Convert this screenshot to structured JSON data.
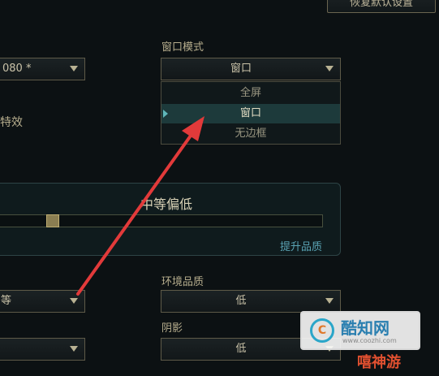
{
  "top_right": {
    "reset_label": "恢复默认设置"
  },
  "left_column": {
    "resolution_value": "080 *",
    "effects_label": "特效",
    "quality_value": "等",
    "bottom_value": ""
  },
  "window_mode": {
    "label": "窗口模式",
    "value": "窗口",
    "options": [
      {
        "label": "全屏",
        "selected": false
      },
      {
        "label": "窗口",
        "selected": true
      },
      {
        "label": "无边框",
        "selected": false
      }
    ]
  },
  "quality_panel": {
    "title": "中等偏低",
    "slider_level": 0.18,
    "improve_link": "提升品质"
  },
  "environment_quality": {
    "label": "环境品质",
    "value": "低"
  },
  "shadows": {
    "label": "阴影",
    "value": "低"
  },
  "watermark": {
    "logo_text": "C",
    "site_name": "酷知网",
    "url": "www.coozhi.com",
    "badge": "嘻神游"
  },
  "colors": {
    "accent": "#5fb7b9",
    "text": "#c9c2a8",
    "arrow": "#e23a3a"
  }
}
